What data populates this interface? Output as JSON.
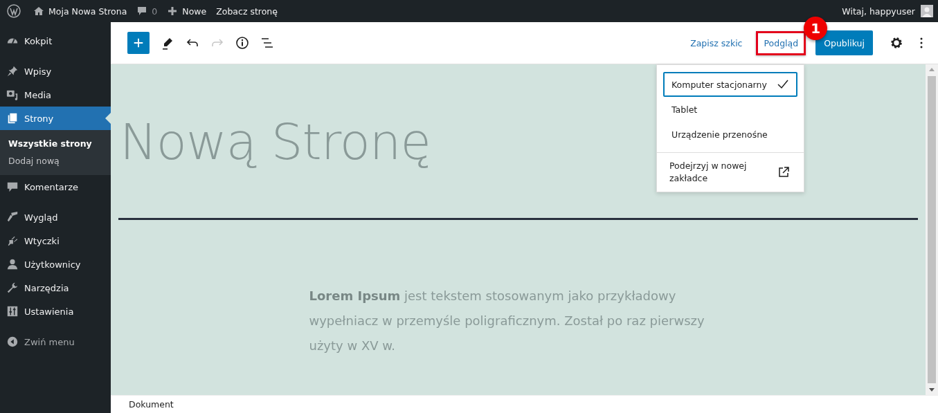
{
  "admin_bar": {
    "site_name": "Moja Nowa Strona",
    "comments_count": "0",
    "new_label": "Nowe",
    "view_label": "Zobacz stronę",
    "greeting": "Witaj, happyuser"
  },
  "sidebar": {
    "groups": [
      [
        {
          "label": "Kokpit",
          "selected": false
        }
      ],
      [
        {
          "label": "Wpisy",
          "selected": false
        },
        {
          "label": "Media",
          "selected": false
        },
        {
          "label": "Strony",
          "selected": true,
          "children": [
            {
              "label": "Wszystkie strony",
              "selected": true
            },
            {
              "label": "Dodaj nową",
              "selected": false
            }
          ]
        },
        {
          "label": "Komentarze",
          "selected": false
        }
      ],
      [
        {
          "label": "Wygląd",
          "selected": false
        },
        {
          "label": "Wtyczki",
          "selected": false
        },
        {
          "label": "Użytkownicy",
          "selected": false
        },
        {
          "label": "Narzędzia",
          "selected": false
        },
        {
          "label": "Ustawienia",
          "selected": false
        }
      ]
    ],
    "collapse_label": "Zwiń menu"
  },
  "toolbar": {
    "undo": {
      "disabled": false
    },
    "redo": {
      "disabled": true
    },
    "save_draft": "Zapisz szkic",
    "preview": {
      "label": "Podgląd",
      "highlighted": true
    },
    "publish": "Opublikuj"
  },
  "annotation": {
    "label": "1"
  },
  "preview_menu": {
    "devices": [
      {
        "label": "Komputer stacjonarny",
        "selected": true
      },
      {
        "label": "Tablet",
        "selected": false
      },
      {
        "label": "Urządzenie przenośne",
        "selected": false
      }
    ],
    "new_tab": "Podejrzyj w nowej zakładce"
  },
  "canvas": {
    "title": "Nową Stronę",
    "paragraph": "**Lorem Ipsum** jest tekstem stosowanym jako przykładowy wypełniacz w przemyśle poligraficznym. Został po raz pierwszy użyty w XV w."
  },
  "footer": {
    "breadcrumb": "Dokument"
  }
}
